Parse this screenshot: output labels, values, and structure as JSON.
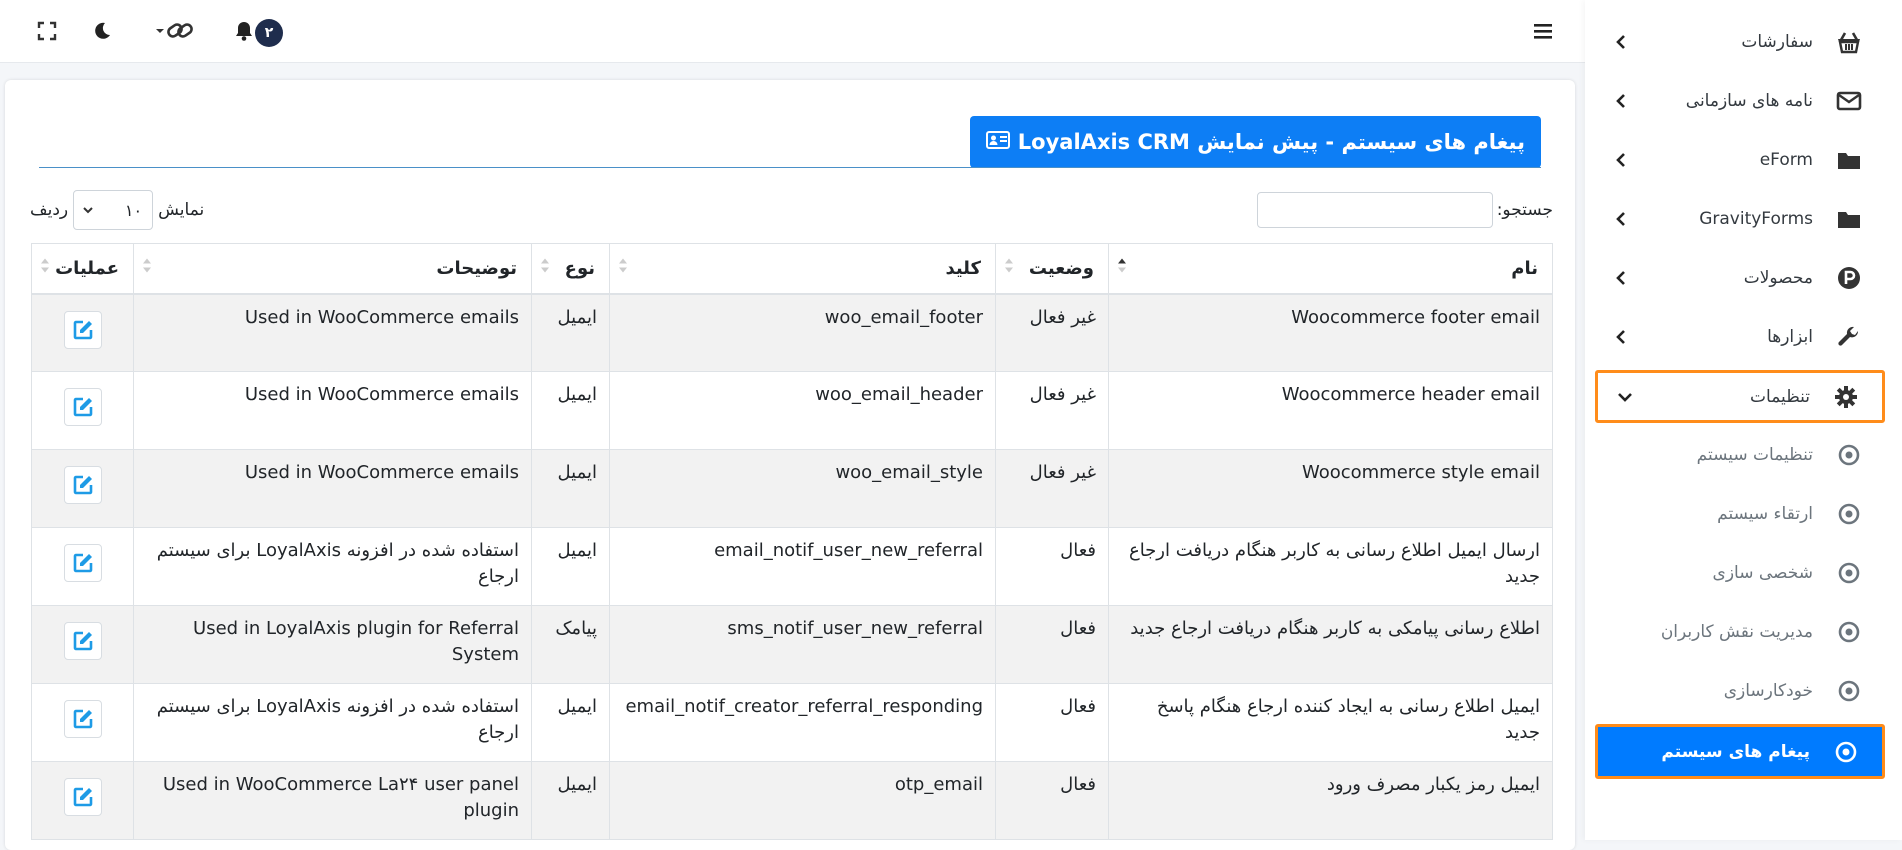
{
  "topbar": {
    "notification_count": "۲",
    "icons": [
      "menu-icon",
      "bell-icon",
      "link-icon",
      "moon-icon",
      "fullscreen-icon"
    ]
  },
  "sidebar": {
    "items": [
      {
        "label": "سفارشات",
        "icon": "basket-icon"
      },
      {
        "label": "نامه های سازمانی",
        "icon": "envelope-icon"
      },
      {
        "label": "eForm",
        "icon": "folder-icon"
      },
      {
        "label": "GravityForms",
        "icon": "folder-icon"
      },
      {
        "label": "محصولات",
        "icon": "product-icon"
      },
      {
        "label": "ابزارها",
        "icon": "wrench-icon"
      },
      {
        "label": "تنظیمات",
        "icon": "gear-icon"
      }
    ],
    "sub_items": [
      {
        "label": "تنظیمات سیستم"
      },
      {
        "label": "ارتقاء سیستم"
      },
      {
        "label": "شخصی سازی"
      },
      {
        "label": "مدیریت نقش کاربران"
      },
      {
        "label": "خودکارسازی"
      },
      {
        "label": "پیغام های سیستم"
      }
    ],
    "colors": {
      "active_bg": "#007bff",
      "highlight_border": "#ff8c1a"
    }
  },
  "card": {
    "title": "پیغام های سیستم - پیش نمایش LoyalAxis CRM",
    "search_label": "جستجو:",
    "search_value": "",
    "length_label_before": "نمایش",
    "length_value": "۱۰",
    "length_label_after": "ردیف"
  },
  "table": {
    "headers": [
      "نام",
      "وضعیت",
      "کلید",
      "نوع",
      "توضیحات",
      "عملیات"
    ],
    "rows": [
      {
        "name": "Woocommerce footer email",
        "status": "غیر فعال",
        "key": "woo_email_footer",
        "type": "ایمیل",
        "desc": "Used in WooCommerce emails"
      },
      {
        "name": "Woocommerce header email",
        "status": "غیر فعال",
        "key": "woo_email_header",
        "type": "ایمیل",
        "desc": "Used in WooCommerce emails"
      },
      {
        "name": "Woocommerce style email",
        "status": "غیر فعال",
        "key": "woo_email_style",
        "type": "ایمیل",
        "desc": "Used in WooCommerce emails"
      },
      {
        "name": "ارسال ایمیل اطلاع رسانی به کاربر هنگام دریافت ارجاع جدید",
        "status": "فعال",
        "key": "email_notif_user_new_referral",
        "type": "ایمیل",
        "desc": "استفاده شده در افزونه LoyalAxis برای سیستم ارجاع"
      },
      {
        "name": "اطلاع رسانی پیامکی به کاربر هنگام دریافت ارجاع جدید",
        "status": "فعال",
        "key": "sms_notif_user_new_referral",
        "type": "پیامک",
        "desc": "Used in LoyalAxis plugin for Referral System"
      },
      {
        "name": "ایمیل اطلاع رسانی به ایجاد کننده ارجاع هنگام پاسخ جدید",
        "status": "فعال",
        "key": "email_notif_creator_referral_responding",
        "type": "ایمیل",
        "desc": "استفاده شده در افزونه LoyalAxis برای سیستم ارجاع"
      },
      {
        "name": "ایمیل رمز یکبار مصرف ورود",
        "status": "فعال",
        "key": "otp_email",
        "type": "ایمیل",
        "desc": "Used in WooCommerce La۲۴ user panel plugin"
      }
    ]
  }
}
